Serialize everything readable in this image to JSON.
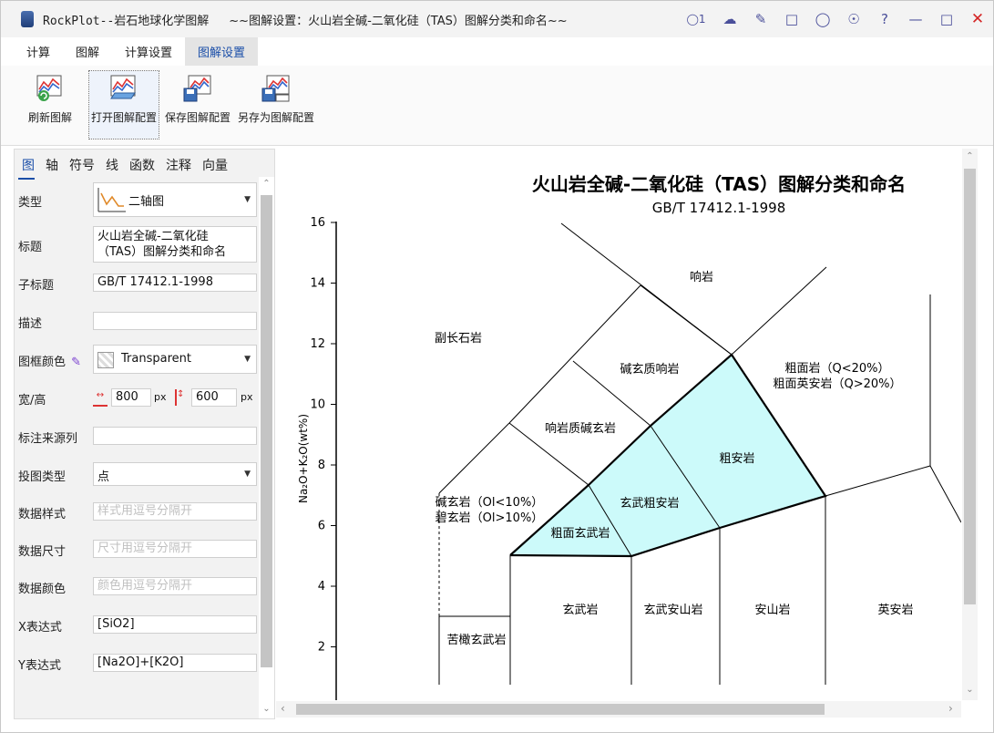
{
  "window": {
    "app_title": "RockPlot--岩石地球化学图解",
    "doc_title": "~~图解设置：火山岩全碱-二氧化硅（TAS）图解分类和命名~~",
    "user_count": "1",
    "icons": [
      "user-icon",
      "cloud-sync-icon",
      "eraser-icon",
      "chat-icon",
      "dollar-icon",
      "globe-icon",
      "help-icon",
      "minimize-icon",
      "maximize-icon",
      "close-icon"
    ]
  },
  "menu": {
    "tabs": [
      "计算",
      "图解",
      "计算设置",
      "图解设置"
    ],
    "active": "图解设置"
  },
  "ribbon": {
    "buttons": [
      {
        "label": "刷新图解",
        "icon": "refresh-chart-icon"
      },
      {
        "label": "打开图解配置",
        "icon": "open-config-icon"
      },
      {
        "label": "保存图解配置",
        "icon": "save-config-icon"
      },
      {
        "label": "另存为图解配置",
        "icon": "save-as-config-icon"
      }
    ]
  },
  "panel": {
    "tabs": [
      "图",
      "轴",
      "符号",
      "线",
      "函数",
      "注释",
      "向量"
    ],
    "type_label": "类型",
    "type_value": "二轴图",
    "title_label": "标题",
    "title_line1": "火山岩全碱-二氧化硅",
    "title_line2": "（TAS）图解分类和命名",
    "subtitle_label": "子标题",
    "subtitle_value": "GB/T 17412.1-1998",
    "desc_label": "描述",
    "desc_value": "",
    "frame_color_label": "图框颜色",
    "frame_color_value": "Transparent",
    "size_label": "宽/高",
    "width_value": "800",
    "height_value": "600",
    "px_unit": "px",
    "source_col_label": "标注来源列",
    "source_col_value": "",
    "plot_type_label": "投图类型",
    "plot_type_value": "点",
    "data_style_label": "数据样式",
    "data_style_placeholder": "样式用逗号分隔开",
    "data_size_label": "数据尺寸",
    "data_size_placeholder": "尺寸用逗号分隔开",
    "data_color_label": "数据颜色",
    "data_color_placeholder": "颜色用逗号分隔开",
    "x_expr_label": "X表达式",
    "x_expr_value": "[SiO2]",
    "y_expr_label": "Y表达式",
    "y_expr_value": "[Na2O]+[K2O]"
  },
  "chart_data": {
    "type": "line",
    "title": "火山岩全碱-二氧化硅（TAS）图解分类和命名",
    "subtitle": "GB/T 17412.1-1998",
    "ylabel": "Na₂O+K₂O(wt%)",
    "ylim": [
      0,
      16
    ],
    "yticks": [
      "2",
      "4",
      "6",
      "8",
      "10",
      "12",
      "14",
      "16"
    ],
    "highlight_color": "#ccfafa",
    "field_labels": [
      "响岩",
      "副长石岩",
      "碱玄质响岩",
      "粗面岩（Q<20%）",
      "粗面英安岩（Q>20%）",
      "响岩质碱玄岩",
      "粗安岩",
      "碱玄岩（Ol<10%）",
      "碧玄岩（Ol>10%）",
      "玄武粗安岩",
      "粗面玄武岩",
      "玄武岩",
      "玄武安山岩",
      "安山岩",
      "英安岩",
      "苦橄玄武岩"
    ]
  }
}
